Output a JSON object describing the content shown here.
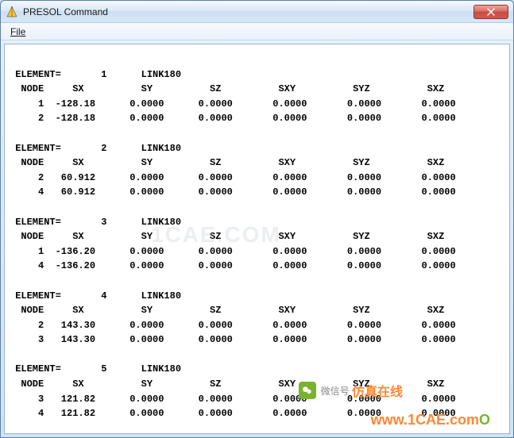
{
  "title": "PRESOL  Command",
  "menu": {
    "file": "File"
  },
  "headers": {
    "element": "ELEMENT=",
    "node": "NODE",
    "sx": "SX",
    "sy": "SY",
    "sz": "SZ",
    "sxy": "SXY",
    "syz": "SYZ",
    "sxz": "SXZ",
    "link": "LINK180"
  },
  "elements": [
    {
      "id": "1",
      "type": "LINK180",
      "rows": [
        {
          "node": "1",
          "sx": "-128.18",
          "sy": "0.0000",
          "sz": "0.0000",
          "sxy": "0.0000",
          "syz": "0.0000",
          "sxz": "0.0000"
        },
        {
          "node": "2",
          "sx": "-128.18",
          "sy": "0.0000",
          "sz": "0.0000",
          "sxy": "0.0000",
          "syz": "0.0000",
          "sxz": "0.0000"
        }
      ]
    },
    {
      "id": "2",
      "type": "LINK180",
      "rows": [
        {
          "node": "2",
          "sx": "60.912",
          "sy": "0.0000",
          "sz": "0.0000",
          "sxy": "0.0000",
          "syz": "0.0000",
          "sxz": "0.0000"
        },
        {
          "node": "4",
          "sx": "60.912",
          "sy": "0.0000",
          "sz": "0.0000",
          "sxy": "0.0000",
          "syz": "0.0000",
          "sxz": "0.0000"
        }
      ]
    },
    {
      "id": "3",
      "type": "LINK180",
      "rows": [
        {
          "node": "1",
          "sx": "-136.20",
          "sy": "0.0000",
          "sz": "0.0000",
          "sxy": "0.0000",
          "syz": "0.0000",
          "sxz": "0.0000"
        },
        {
          "node": "4",
          "sx": "-136.20",
          "sy": "0.0000",
          "sz": "0.0000",
          "sxy": "0.0000",
          "syz": "0.0000",
          "sxz": "0.0000"
        }
      ]
    },
    {
      "id": "4",
      "type": "LINK180",
      "rows": [
        {
          "node": "2",
          "sx": "143.30",
          "sy": "0.0000",
          "sz": "0.0000",
          "sxy": "0.0000",
          "syz": "0.0000",
          "sxz": "0.0000"
        },
        {
          "node": "3",
          "sx": "143.30",
          "sy": "0.0000",
          "sz": "0.0000",
          "sxy": "0.0000",
          "syz": "0.0000",
          "sxz": "0.0000"
        }
      ]
    },
    {
      "id": "5",
      "type": "LINK180",
      "rows": [
        {
          "node": "3",
          "sx": "121.82",
          "sy": "0.0000",
          "sz": "0.0000",
          "sxy": "0.0000",
          "syz": "0.0000",
          "sxz": "0.0000"
        },
        {
          "node": "4",
          "sx": "121.82",
          "sy": "0.0000",
          "sz": "0.0000",
          "sxy": "0.0000",
          "syz": "0.0000",
          "sxz": "0.0000"
        }
      ]
    }
  ],
  "watermarks": {
    "center": "1CAE.COM",
    "wechat_label": "微信号",
    "wechat_value": "仿真在线",
    "url": "www.1CAE.com",
    "O": "O"
  }
}
